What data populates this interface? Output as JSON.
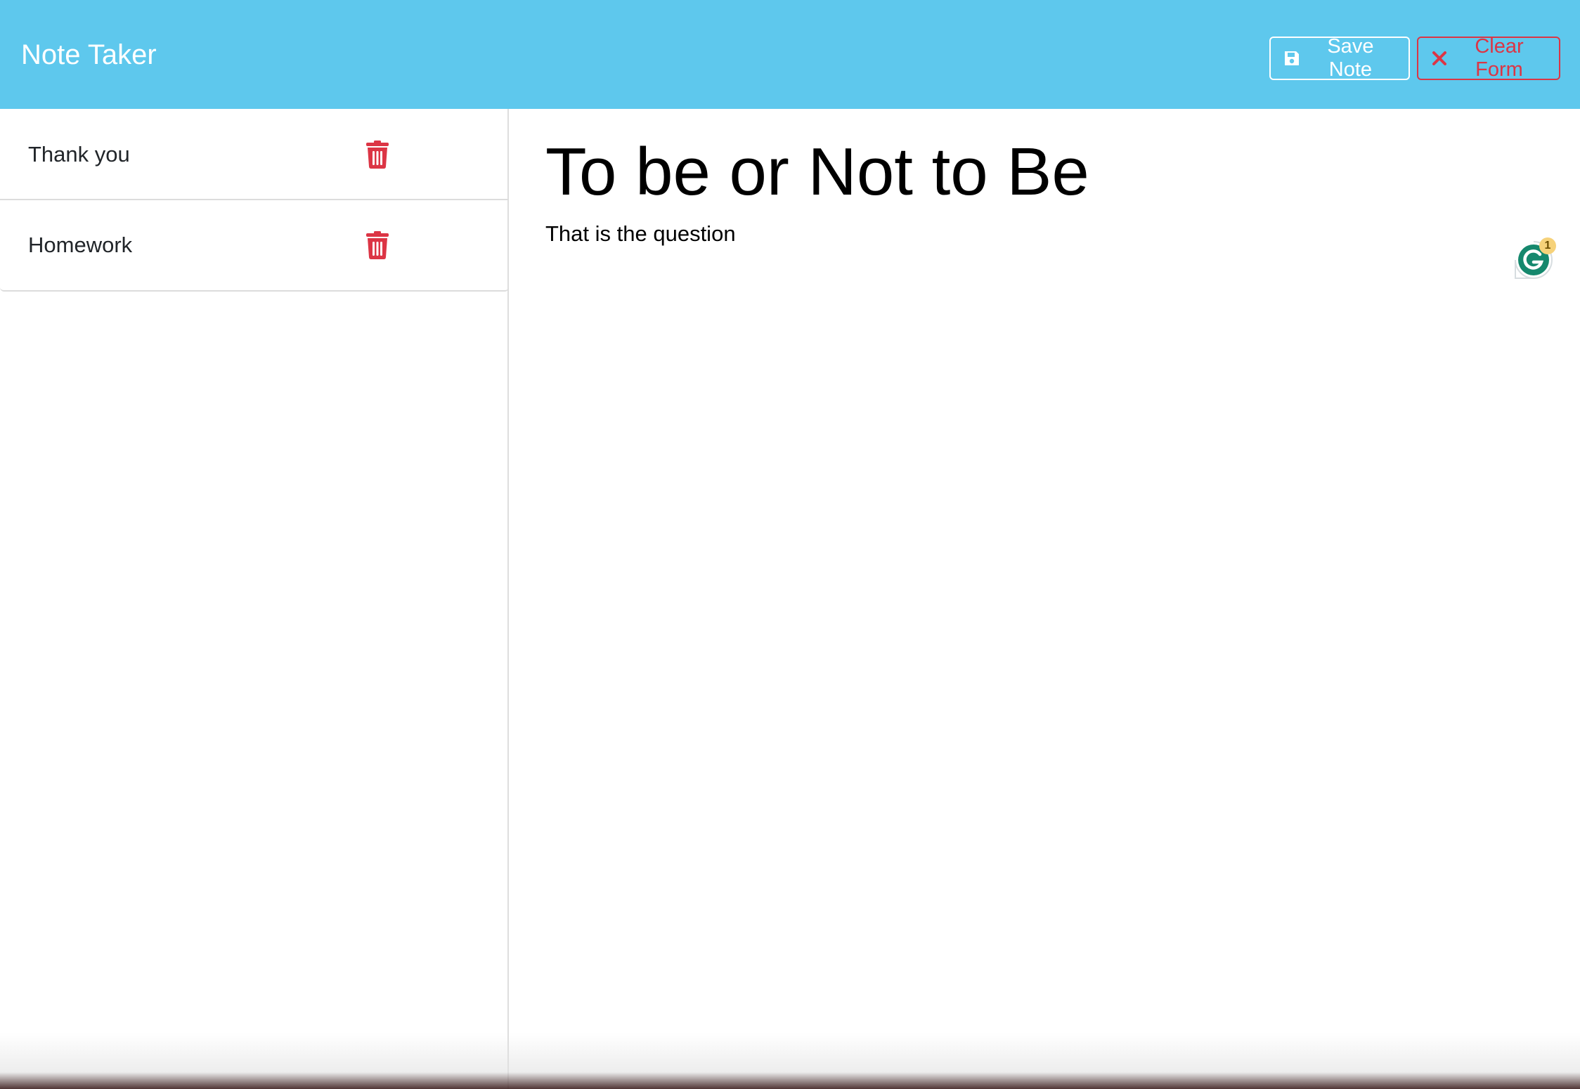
{
  "navbar": {
    "brand": "Note Taker",
    "save_label": "Save Note",
    "clear_label": "Clear Form"
  },
  "sidebar": {
    "notes": [
      {
        "title": "Thank you"
      },
      {
        "title": "Homework"
      }
    ]
  },
  "editor": {
    "title_value": "To be or Not to Be",
    "text_value": "That is the question"
  },
  "grammarly": {
    "count": "1"
  },
  "colors": {
    "navbar_bg": "#5ec8ed",
    "danger": "#dc3545",
    "white": "#ffffff"
  },
  "icons": {
    "save": "floppy-disk-icon",
    "clear": "x-mark-icon",
    "delete": "trash-icon",
    "grammarly": "grammarly-icon"
  }
}
